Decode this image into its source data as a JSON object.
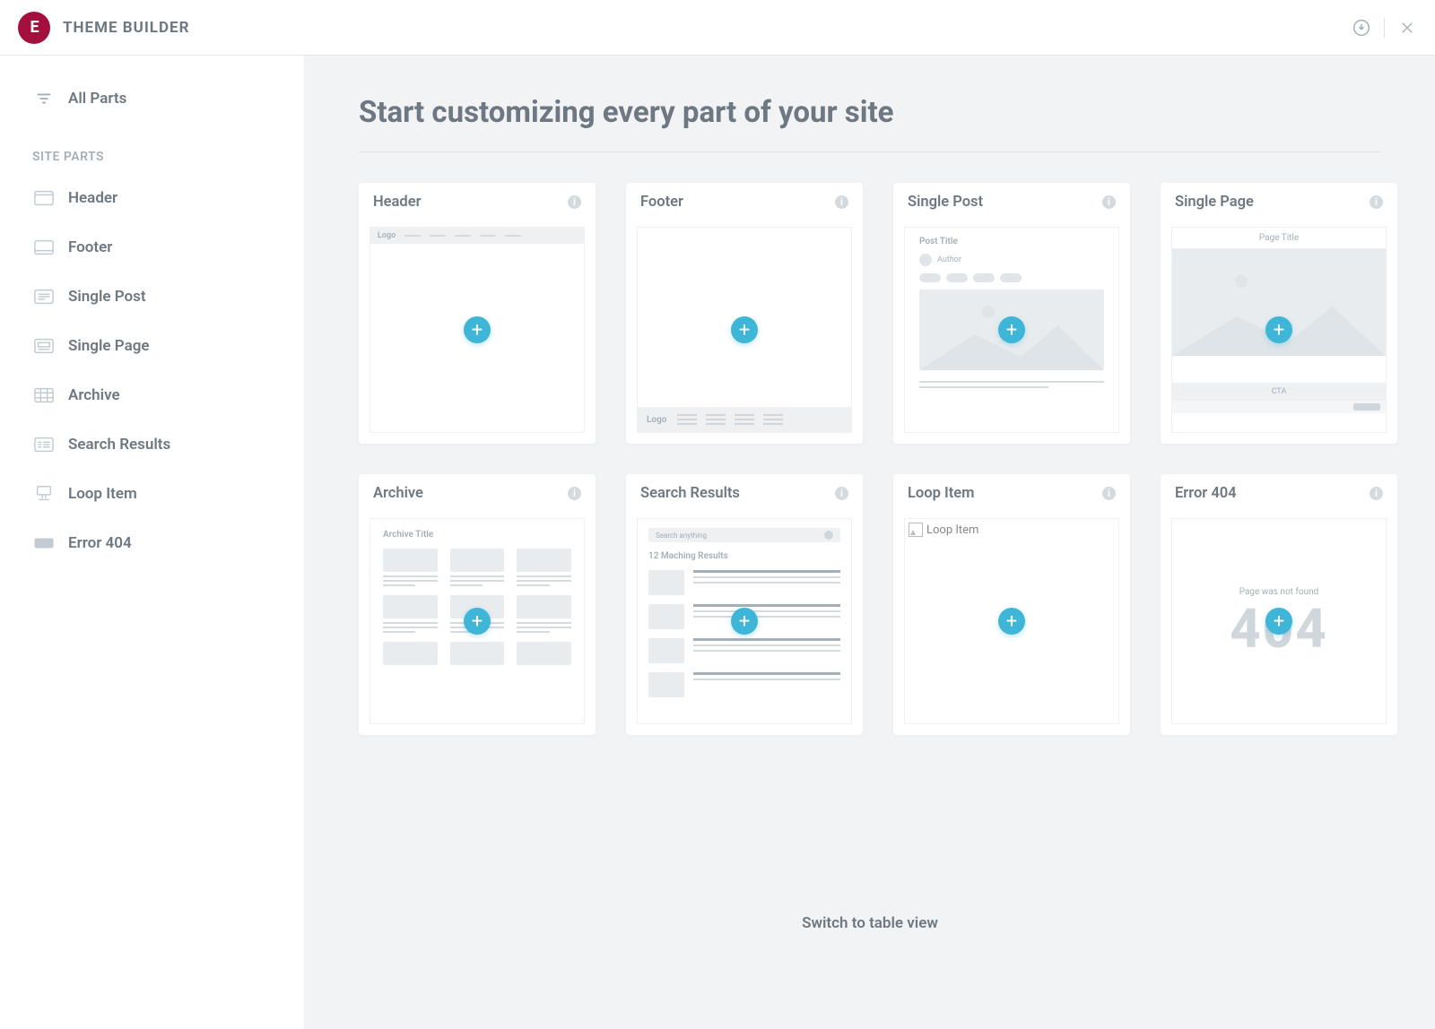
{
  "appTitle": "THEME BUILDER",
  "sidebar": {
    "allParts": "All Parts",
    "sectionLabel": "SITE PARTS",
    "items": [
      {
        "label": "Header"
      },
      {
        "label": "Footer"
      },
      {
        "label": "Single Post"
      },
      {
        "label": "Single Page"
      },
      {
        "label": "Archive"
      },
      {
        "label": "Search Results"
      },
      {
        "label": "Loop Item"
      },
      {
        "label": "Error 404"
      }
    ]
  },
  "main": {
    "title": "Start customizing every part of your site",
    "switchLink": "Switch to table view",
    "cards": {
      "header": {
        "title": "Header",
        "logoLabel": "Logo"
      },
      "footer": {
        "title": "Footer",
        "logoLabel": "Logo"
      },
      "singlePost": {
        "title": "Single Post",
        "postTitle": "Post Title",
        "author": "Author"
      },
      "singlePage": {
        "title": "Single Page",
        "pageTitle": "Page Title",
        "cta": "CTA"
      },
      "archive": {
        "title": "Archive",
        "archiveTitle": "Archive Title"
      },
      "search": {
        "title": "Search Results",
        "placeholder": "Search anything",
        "count": "12 Maching Results"
      },
      "loop": {
        "title": "Loop Item",
        "placeholder": "Loop Item"
      },
      "error404": {
        "title": "Error 404",
        "message": "Page was not found",
        "code": "404"
      }
    }
  }
}
